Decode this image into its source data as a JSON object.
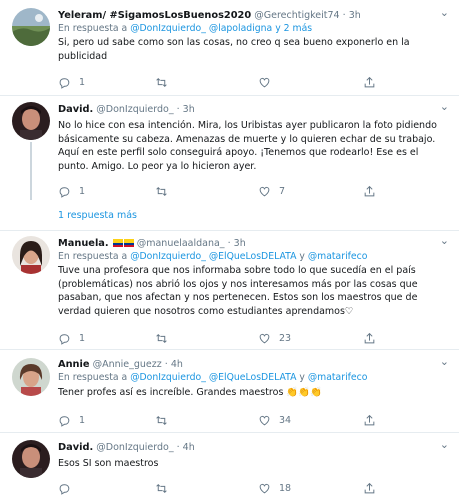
{
  "tweets": [
    {
      "name": "Yeleram/ #SigamosLosBuenos2020",
      "handle": "@Gerechtigkeit74",
      "dot": "·",
      "time": "3h",
      "reply_prefix": "En respuesta a ",
      "reply_to": "@DonIzquierdo_ @lapoladigna",
      "reply_more": " y 2 más",
      "text": "Si, pero ud sabe como son las cosas, no creo q sea bueno exponerlo en la publicidad",
      "replies": "1",
      "retweets": "",
      "likes": ""
    },
    {
      "name": "David.",
      "handle": "@DonIzquierdo_",
      "dot": "·",
      "time": "3h",
      "text": "No lo hice con esa intención. Mira, los Uribistas ayer publicaron la foto pidiendo básicamente su cabeza. Amenazas de muerte y lo quieren echar de su trabajo. Aquí en este perfil solo conseguirá apoyo. ¡Tenemos que rodearlo! Ese es el punto. Amigo. Lo peor ya lo hicieron ayer.",
      "replies": "1",
      "retweets": "",
      "likes": "7"
    },
    {
      "name": "Manuela.",
      "handle": "@manuelaaldana_",
      "dot": "·",
      "time": "3h",
      "reply_prefix": "En respuesta a ",
      "reply_to": "@DonIzquierdo_ @ElQueLosDELATA",
      "reply_and": " y ",
      "reply_to2": "@matarifeco",
      "text": "Tuve una profesora que nos informaba sobre todo lo que sucedía en el país (problemáticas) nos abrió los ojos y nos interesamos más por las cosas que pasaban, que nos afectan y nos pertenecen. Estos son los maestros que de verdad quieren que nosotros como estudiantes aprendamos♡",
      "replies": "1",
      "retweets": "",
      "likes": "23"
    },
    {
      "name": "Annie",
      "handle": "@Annie_guezz",
      "dot": "·",
      "time": "4h",
      "reply_prefix": "En respuesta a ",
      "reply_to": "@DonIzquierdo_ @ElQueLosDELATA",
      "reply_and": " y ",
      "reply_to2": "@matarifeco",
      "text": "Tener profes así es increíble. Grandes maestros 👏👏👏",
      "replies": "1",
      "retweets": "",
      "likes": "34"
    },
    {
      "name": "David.",
      "handle": "@DonIzquierdo_",
      "dot": "·",
      "time": "4h",
      "text": "Esos SI son maestros",
      "replies": "",
      "retweets": "",
      "likes": "18"
    }
  ],
  "show_more_label": "1 respuesta más",
  "icons": {
    "reply": "reply-icon",
    "retweet": "retweet-icon",
    "like": "heart-icon",
    "share": "share-icon",
    "more": "more-options-icon"
  },
  "colors": {
    "link": "#1b95e0",
    "muted": "#657786",
    "divider": "#e6ecf0"
  }
}
